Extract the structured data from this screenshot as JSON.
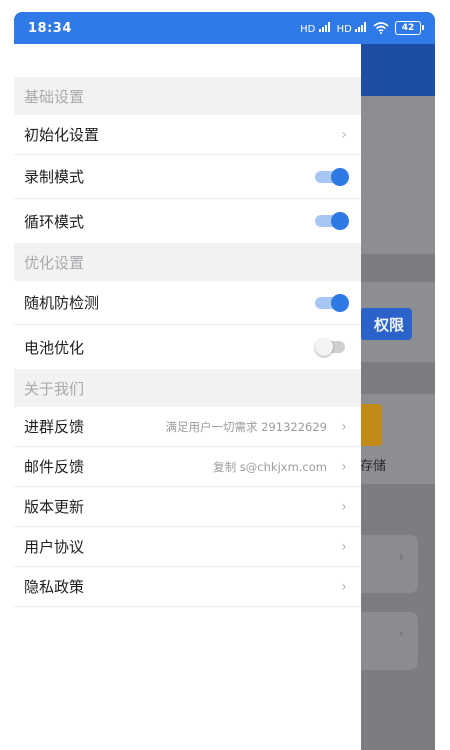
{
  "status": {
    "time": "18:34",
    "signal1": "HD",
    "signal2": "HD",
    "battery": "42"
  },
  "background": {
    "permission_button": "权限",
    "storage_label": "存储"
  },
  "drawer": {
    "sections": [
      {
        "title": "基础设置",
        "items": [
          {
            "label": "初始化设置",
            "hint": "",
            "control": "chevron"
          },
          {
            "label": "录制模式",
            "hint": "",
            "control": "toggle-on"
          },
          {
            "label": "循环模式",
            "hint": "",
            "control": "toggle-on"
          }
        ]
      },
      {
        "title": "优化设置",
        "items": [
          {
            "label": "随机防检测",
            "hint": "",
            "control": "toggle-on"
          },
          {
            "label": "电池优化",
            "hint": "",
            "control": "toggle-off"
          }
        ]
      },
      {
        "title": "关于我们",
        "items": [
          {
            "label": "进群反馈",
            "hint": "满足用户一切需求 291322629",
            "control": "chevron"
          },
          {
            "label": "邮件反馈",
            "hint": "复制 s@chkjxm.com",
            "control": "chevron"
          },
          {
            "label": "版本更新",
            "hint": "",
            "control": "chevron"
          },
          {
            "label": "用户协议",
            "hint": "",
            "control": "chevron"
          },
          {
            "label": "隐私政策",
            "hint": "",
            "control": "chevron"
          }
        ]
      }
    ]
  },
  "colors": {
    "accent": "#2f7ae6",
    "toggle_on": "#2d7ae5"
  }
}
